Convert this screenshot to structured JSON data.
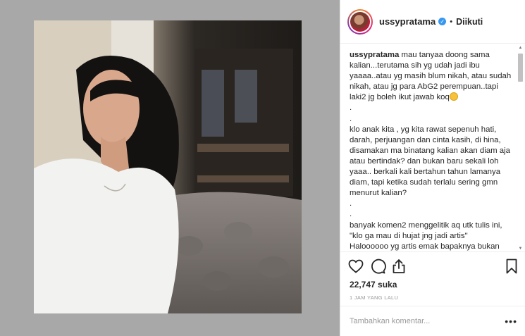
{
  "post": {
    "photo_alt": "",
    "header": {
      "username": "ussypratama",
      "verified_icon": "verified-badge-icon",
      "separator": "•",
      "follow_status": "Diikuti"
    },
    "caption": {
      "owner": "ussypratama",
      "intro": "mau tanyaa doong sama kalian...terutama sih yg udah jadi ibu yaaaa..atau yg masih blum nikah, atau sudah nikah, atau jg para AbG2 perempuan..tapi laki2 jg boleh ikut jawab koq",
      "dots": [
        ".",
        "."
      ],
      "para2": "klo anak kita , yg kita rawat sepenuh hati, darah, perjuangan dan cinta kasih, di hina, disamakan ma binatang kalian akan diam aja atau bertindak? dan bukan baru sekali loh yaaa.. berkali kali bertahun tahun lamanya diam, tapi ketika sudah terlalu sering gmn menurut kalian?",
      "dots2": [
        ".",
        "."
      ],
      "para3_line1": "banyak komen2 menggelitik aq utk tulis ini,",
      "para3_line2": "\"klo ga mau di hujat jng jadi artis\"",
      "para3_line3": "Haloooooo yg artis emak bapaknya bukan"
    },
    "likes": "22,747 suka",
    "time": "1 JAM YANG LALU",
    "comment_placeholder": "Tambahkan komentar...",
    "more_label": "•••"
  },
  "colors": {
    "verified": "#3897f0",
    "panel_bg": "#a8a8a8"
  }
}
